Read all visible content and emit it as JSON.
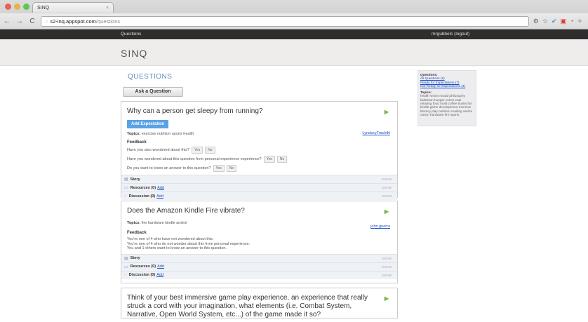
{
  "browser": {
    "tab_title": "SINQ",
    "tab_close": "×",
    "back": "←",
    "forward": "→",
    "reload": "C",
    "url_host": "s2-inq.appspot.com",
    "url_path": "/questions"
  },
  "topbar": {
    "questions_link": "Questions",
    "user": "mrgubbels (logout)"
  },
  "site": {
    "logo": "SINQ"
  },
  "main": {
    "heading": "QUESTIONS",
    "ask_button": "Ask a Question"
  },
  "sidebar": {
    "questions_label": "Questions:",
    "all_questions": "All Questions (6)",
    "ready": "Ready for Expectations (7)",
    "not_ready": "Not Ready for Expectations (4)",
    "topics_label": "Topics:",
    "topics_text": "health vision mould philosophy kidsteam hunger colors cats relaxing food mold coffee books fun kindle game development exercise literacy play nutrition reading androi canon hardware fire sports"
  },
  "labels": {
    "topics": "Topics:",
    "feedback": "Feedback",
    "yes": "Yes",
    "no": "No",
    "story": "Story",
    "resources": "Resources (0)",
    "discussion": "Discussion (0)",
    "add": "Add",
    "show": "SHOW"
  },
  "questions": [
    {
      "title": "Why can a person get sleepy from running?",
      "add_expectation": "Add Expectation",
      "topics": "exercise nutrition sports health",
      "user": "LyndseyTrachtki",
      "fb_q1": "Have you also wondered about this?",
      "fb_q2": "Have you wondered about this question from personal experience experience?",
      "fb_q3": "Do you want to know an answer to this question?"
    },
    {
      "title": "Does the Amazon Kindle Fire vibrate?",
      "topics": "fire hardware kindle androi",
      "user": "john.guerra",
      "fb_line1": "You're one of 4 who have not wondered about this.",
      "fb_line2": "You're one of 4 who do not wonder about this from personal experience.",
      "fb_line3": "You and 1 others want to know an answer to this question."
    },
    {
      "title": "Think of your best immersive game play experience, an experience that really struck a cord with your imagination, what elements (i.e. Combat System, Narrative, Open World System, etc...) of the game made it so?"
    }
  ],
  "colors": {
    "accent_blue": "#5aa2e6",
    "link_blue": "#1a50c8",
    "topbar_dark": "#2e2e2e",
    "heading_blue": "#6a8fbf"
  }
}
